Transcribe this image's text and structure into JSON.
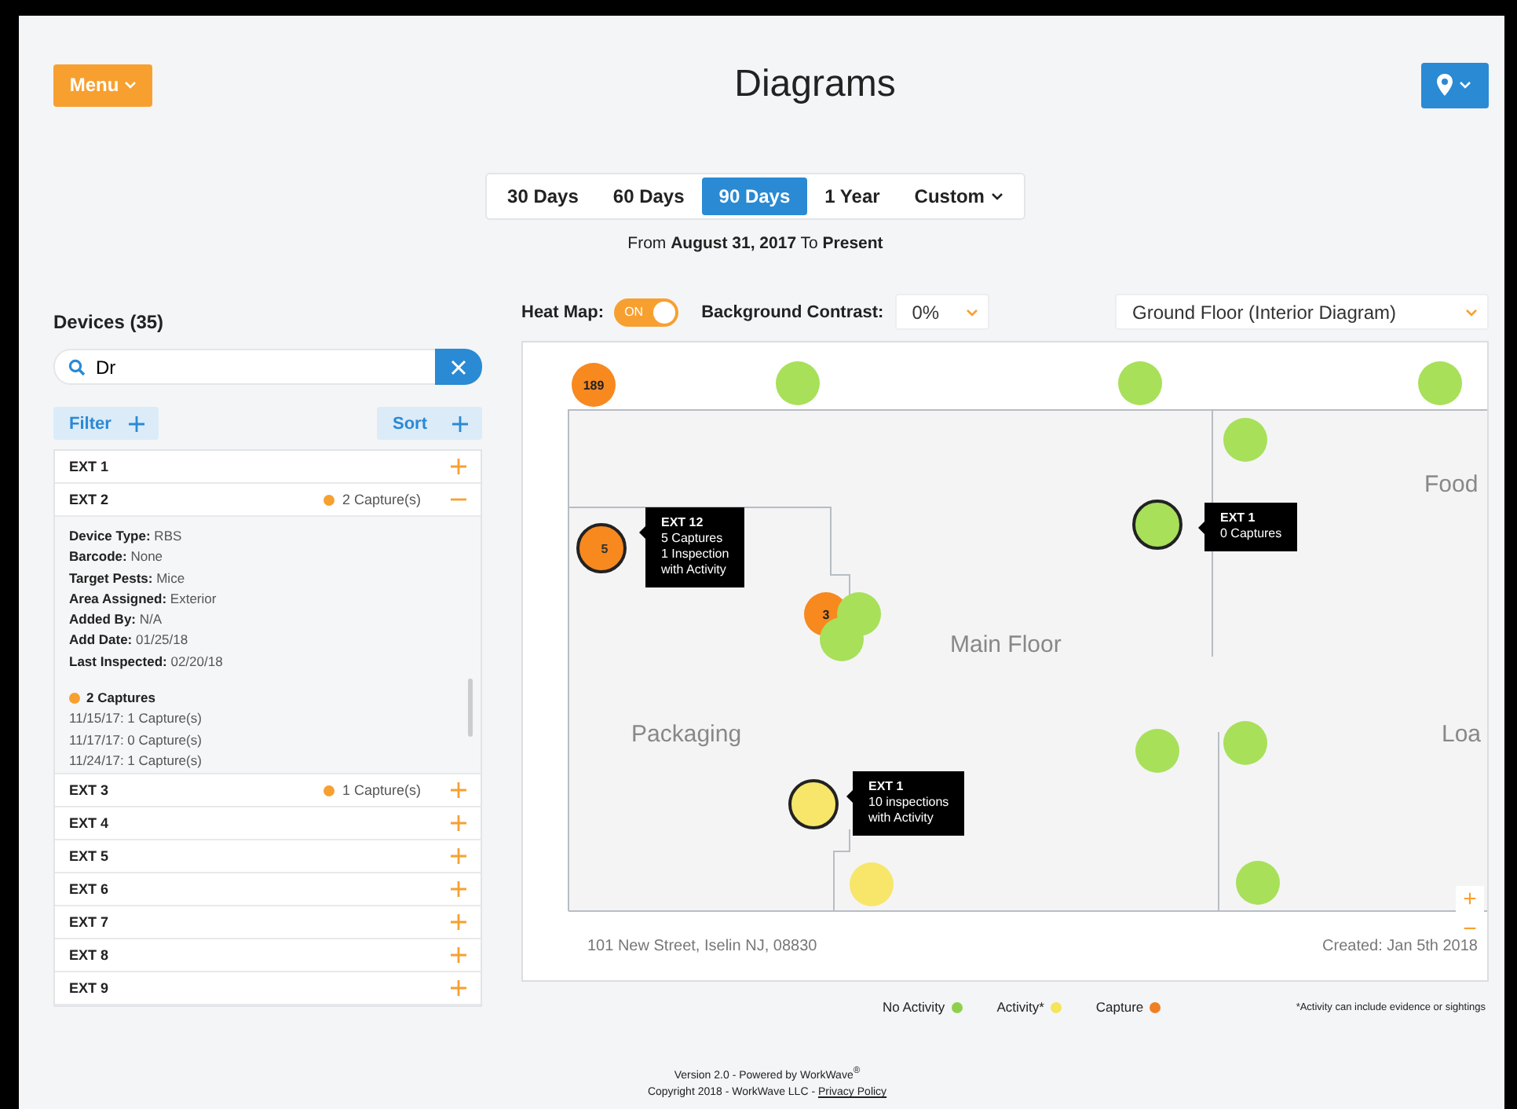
{
  "header": {
    "menu_button": "Menu",
    "title": "Diagrams"
  },
  "range_tabs": [
    {
      "label": "30 Days",
      "selected": false
    },
    {
      "label": "60 Days",
      "selected": false
    },
    {
      "label": "90 Days",
      "selected": true
    },
    {
      "label": "1 Year",
      "selected": false
    },
    {
      "label": "Custom",
      "selected": false
    }
  ],
  "date_range": "From **August 31, 2017** To **Present**",
  "devices": {
    "title": "Devices (35)",
    "search": {
      "value": "Dr"
    },
    "filter_button": "Filter",
    "sort_button": "Sort",
    "items": [
      {
        "name": "EXT 1",
        "expanded": false
      },
      {
        "name": "EXT 2",
        "expanded": true,
        "captures": "2 Capture(s)",
        "details": [
          "**Device Type:** RBS",
          "**Barcode:** None",
          "**Target Pests:** Mice",
          "**Area Assigned:** Exterior",
          "**Added By:** N/A",
          "**Add Date:** 01/25/18",
          "**Last Inspected:** 02/20/18"
        ],
        "history_title": "2 Captures",
        "history": [
          "11/15/17: 1 Capture(s)",
          "11/17/17: 0 Capture(s)",
          "11/24/17: 1 Capture(s)"
        ]
      },
      {
        "name": "EXT 3",
        "expanded": false,
        "captures": "1 Capture(s)"
      },
      {
        "name": "EXT 4",
        "expanded": false
      },
      {
        "name": "EXT 5",
        "expanded": false
      },
      {
        "name": "EXT 6",
        "expanded": false
      },
      {
        "name": "EXT 7",
        "expanded": false
      },
      {
        "name": "EXT 8",
        "expanded": false
      },
      {
        "name": "EXT 9",
        "expanded": false
      }
    ]
  },
  "controls": {
    "heat_map_label": "Heat Map:",
    "heat_map": {
      "on": true,
      "label": "ON"
    },
    "contrast_label": "Background Contrast:",
    "contrast": "0%",
    "floor": "Ground Floor (Interior Diagram)"
  },
  "map": {
    "rooms": [
      "Food",
      "Main Floor",
      "Packaging",
      "Loa"
    ],
    "markers": [
      {
        "kind": "capture",
        "label": "189",
        "selected": false
      },
      {
        "kind": "none",
        "selected": false
      },
      {
        "kind": "none",
        "selected": false
      },
      {
        "kind": "none",
        "selected": false
      },
      {
        "kind": "none",
        "selected": false
      },
      {
        "kind": "capture",
        "label": "5",
        "selected": true
      },
      {
        "kind": "none",
        "selected": true
      },
      {
        "kind": "capture",
        "label": "3",
        "selected": false
      },
      {
        "kind": "none",
        "selected": false
      },
      {
        "kind": "none",
        "selected": false
      },
      {
        "kind": "none",
        "selected": false
      },
      {
        "kind": "none",
        "selected": false
      },
      {
        "kind": "activity",
        "selected": true
      },
      {
        "kind": "activity",
        "selected": false
      },
      {
        "kind": "none",
        "selected": false
      }
    ],
    "tooltips": [
      {
        "title": "EXT 12",
        "lines": [
          "5 Captures",
          "1 Inspection",
          "with Activity"
        ]
      },
      {
        "title": "EXT 1",
        "lines": [
          "0 Captures"
        ]
      },
      {
        "title": "EXT 1",
        "lines": [
          "10 inspections",
          "with Activity"
        ]
      }
    ],
    "zoom_in": "+",
    "zoom_out": "−",
    "address": "101 New Street, Iselin NJ, 08830",
    "created": "Created:  Jan 5th 2018"
  },
  "legend": [
    {
      "label": "No Activity",
      "color": "#8dd14a"
    },
    {
      "label": "Activity*",
      "color": "#f5e45c"
    },
    {
      "label": "Capture",
      "color": "#f07f22"
    }
  ],
  "legend_note": "*Activity can include evidence or sightings",
  "footer": [
    "Version 2.0 - Powered by WorkWave$^{®}$",
    "Copyright 2018 - WorkWave LLC - "
  ],
  "footer_link": "Privacy Policy"
}
